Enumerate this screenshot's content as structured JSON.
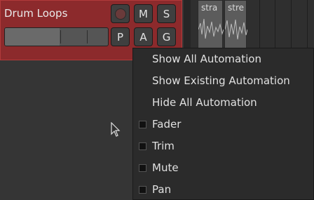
{
  "track": {
    "name": "Drum Loops",
    "buttons_row1": [
      "M",
      "S"
    ],
    "buttons_row2": [
      "P",
      "A",
      "G"
    ],
    "fader_level": 0.53
  },
  "regions": [
    {
      "label": "stra"
    },
    {
      "label": "stre"
    }
  ],
  "menu": {
    "items": [
      {
        "label": "Show All Automation"
      },
      {
        "label": "Show Existing Automation"
      },
      {
        "label": "Hide All Automation"
      }
    ],
    "check_items": [
      {
        "label": "Fader",
        "checked": false
      },
      {
        "label": "Trim",
        "checked": false
      },
      {
        "label": "Mute",
        "checked": false
      },
      {
        "label": "Pan",
        "checked": false
      }
    ]
  },
  "colors": {
    "track_bg": "#8c2a2c",
    "menu_bg": "#2b2b2b",
    "app_bg": "#353535"
  }
}
